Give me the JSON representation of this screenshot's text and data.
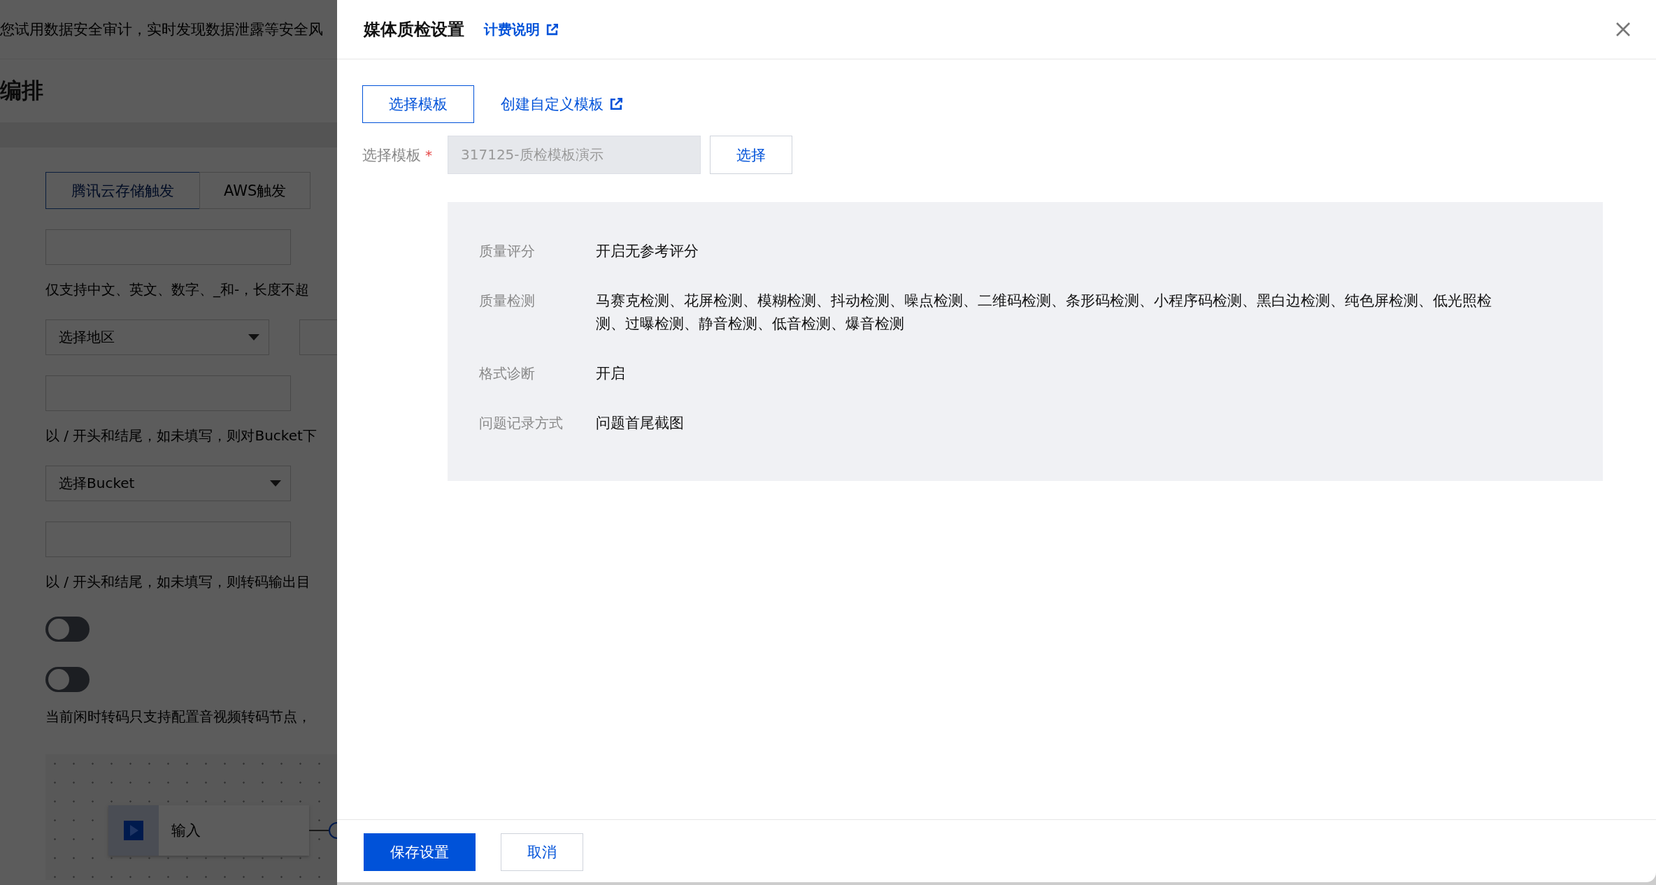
{
  "background_page": {
    "banner": "您试用数据安全审计，实时发现数据泄露等安全风",
    "page_title": "编排",
    "trigger_tabs": [
      {
        "label": "腾讯云存储触发",
        "selected": true
      },
      {
        "label": "AWS触发",
        "selected": false
      }
    ],
    "form": [
      {
        "kind": "input"
      },
      {
        "kind": "hint",
        "text": "仅支持中文、英文、数字、_和-，长度不超"
      },
      {
        "kind": "select_pair",
        "placeholder": "选择地区"
      },
      {
        "kind": "input"
      },
      {
        "kind": "hint",
        "text": "以 / 开头和结尾，如未填写，则对Bucket下"
      },
      {
        "kind": "select",
        "placeholder": "选择Bucket"
      },
      {
        "kind": "input"
      },
      {
        "kind": "hint",
        "text": "以 / 开头和结尾，如未填写，则转码输出目"
      },
      {
        "kind": "toggle",
        "on": false
      },
      {
        "kind": "toggle",
        "on": false
      },
      {
        "kind": "hint",
        "text": "当前闲时转码只支持配置音视频转码节点，"
      }
    ],
    "canvas_node": {
      "label": "输入"
    }
  },
  "drawer": {
    "title": "媒体质检设置",
    "billing_link": "计费说明",
    "mode_button": {
      "label": "选择模板",
      "selected": true
    },
    "create_link": "创建自定义模板",
    "template_field": {
      "label": "选择模板",
      "required": true,
      "required_mark": "*",
      "value": "317125-质检模板演示",
      "button": "选择"
    },
    "details": [
      {
        "label": "质量评分",
        "value": "开启无参考评分"
      },
      {
        "label": "质量检测",
        "value": "马赛克检测、花屏检测、模糊检测、抖动检测、噪点检测、二维码检测、条形码检测、小程序码检测、黑白边检测、纯色屏检测、低光照检测、过曝检测、静音检测、低音检测、爆音检测"
      },
      {
        "label": "格式诊断",
        "value": "开启"
      },
      {
        "label": "问题记录方式",
        "value": "问题首尾截图"
      }
    ],
    "footer_buttons": [
      {
        "label": "保存设置",
        "kind": "primary"
      },
      {
        "label": "取消",
        "kind": "default"
      }
    ]
  }
}
